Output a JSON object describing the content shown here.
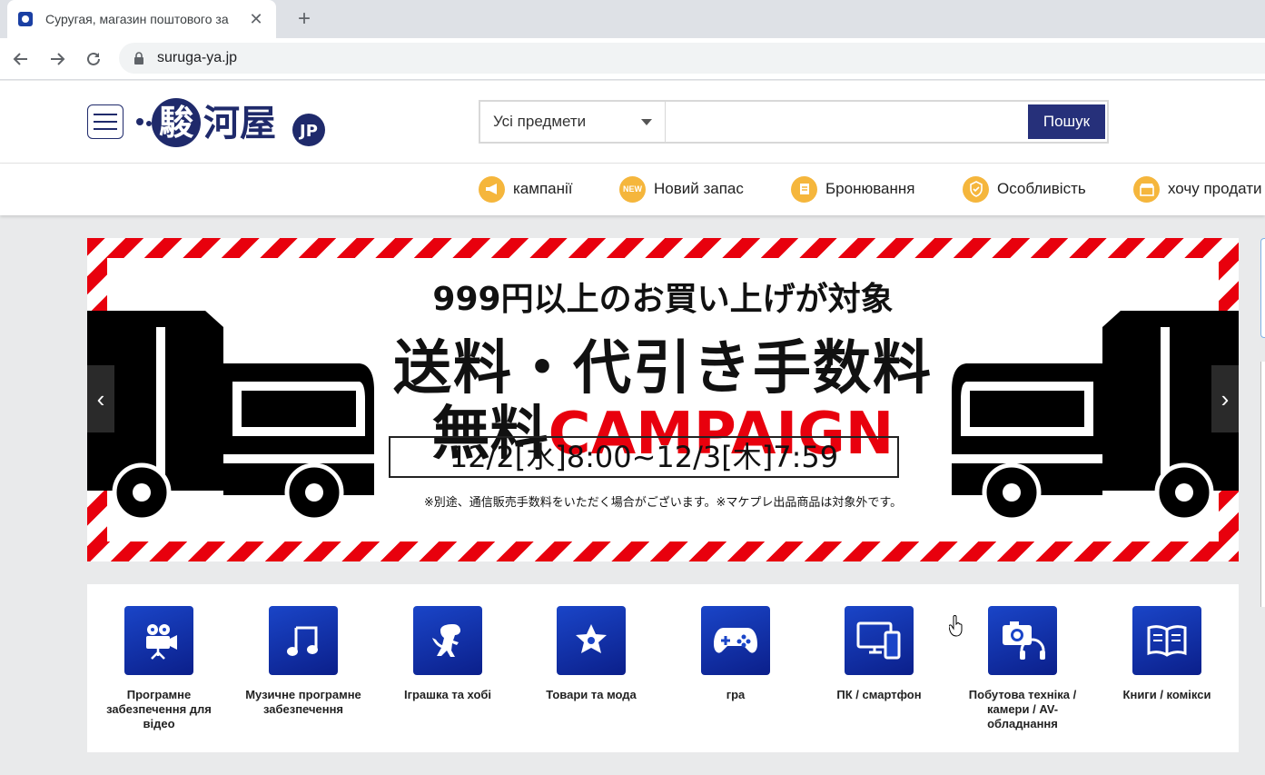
{
  "browser": {
    "tab_title": "Суругая, магазин поштового за",
    "url": "suruga-ya.jp"
  },
  "header": {
    "logo_text": "駿河屋JP",
    "search": {
      "category": "Усі предмети",
      "query": "",
      "button_label": "Пошук"
    }
  },
  "menu": [
    {
      "label": "кампанії",
      "icon": "megaphone-icon"
    },
    {
      "label": "Новий запас",
      "icon": "new-badge-icon"
    },
    {
      "label": "Бронювання",
      "icon": "reservation-icon"
    },
    {
      "label": "Особливість",
      "icon": "shield-check-icon"
    },
    {
      "label": "хочу продати",
      "icon": "store-icon"
    }
  ],
  "banner": {
    "line1": "999円以上のお買い上げが対象",
    "line2": "送料・代引き手数料",
    "line3_black": "無料",
    "line3_red": "CAMPAIGN",
    "dates": "12/2[水]8:00~12/3[木]7:59",
    "note": "※別途、通信販売手数料をいただく場合がございます。※マケプレ出品商品は対象外です。"
  },
  "categories": [
    {
      "label": "Програмне забезпечення для відео",
      "icon": "movie-camera-icon"
    },
    {
      "label": "Музичне програмне забезпечення",
      "icon": "music-note-icon"
    },
    {
      "label": "Іграшка та хобі",
      "icon": "dinosaur-icon"
    },
    {
      "label": "Товари та мода",
      "icon": "star-badge-icon"
    },
    {
      "label": "гра",
      "icon": "gamepad-icon"
    },
    {
      "label": "ПК / смартфон",
      "icon": "pc-smartphone-icon"
    },
    {
      "label": "Побутова техніка / камери / AV-обладнання",
      "icon": "camera-headphones-icon"
    },
    {
      "label": "Книги / комікси",
      "icon": "book-icon"
    }
  ],
  "colors": {
    "brand_navy": "#26307a",
    "accent_orange": "#f5b63c",
    "banner_red": "#e8000d",
    "category_blue": "#1a45c8"
  }
}
